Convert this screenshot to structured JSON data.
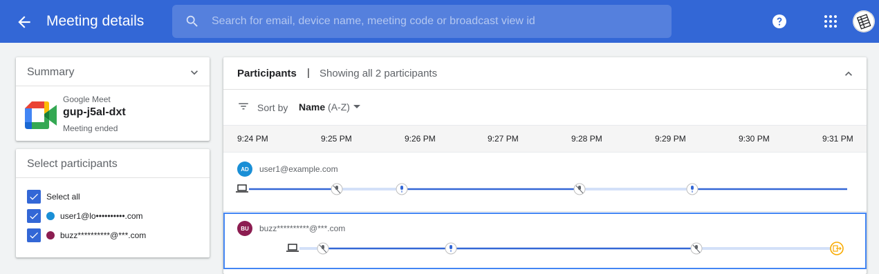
{
  "header": {
    "title": "Meeting details",
    "search_placeholder": "Search for email, device name, meeting code or broadcast view id"
  },
  "summary": {
    "title": "Summary",
    "app": "Google Meet",
    "code": "gup-j5al-dxt",
    "status": "Meeting ended"
  },
  "select": {
    "title": "Select participants",
    "all": "Select all",
    "users": [
      {
        "label": "user1@lo••••••••••.com",
        "color": "#1a8fd6"
      },
      {
        "label": "buzz**********@***.com",
        "color": "#8c1d51"
      }
    ]
  },
  "participants": {
    "title": "Participants",
    "separator": "|",
    "count": "Showing all 2 participants",
    "sort_label": "Sort by",
    "sort_value": "Name",
    "sort_order": "(A-Z)",
    "ticks": [
      "9:24 PM",
      "9:25 PM",
      "9:26 PM",
      "9:27 PM",
      "9:28 PM",
      "9:29 PM",
      "9:30 PM",
      "9:31 PM"
    ],
    "rows": [
      {
        "initials": "AD",
        "email": "user1@example.com",
        "color": "#1a8fd6"
      },
      {
        "initials": "BU",
        "email": "buzz**********@***.com",
        "color": "#8c1d51"
      }
    ]
  },
  "colors": {
    "accent": "#3367d6",
    "selected_border": "#4285f4",
    "leave": "#f9ab00"
  }
}
